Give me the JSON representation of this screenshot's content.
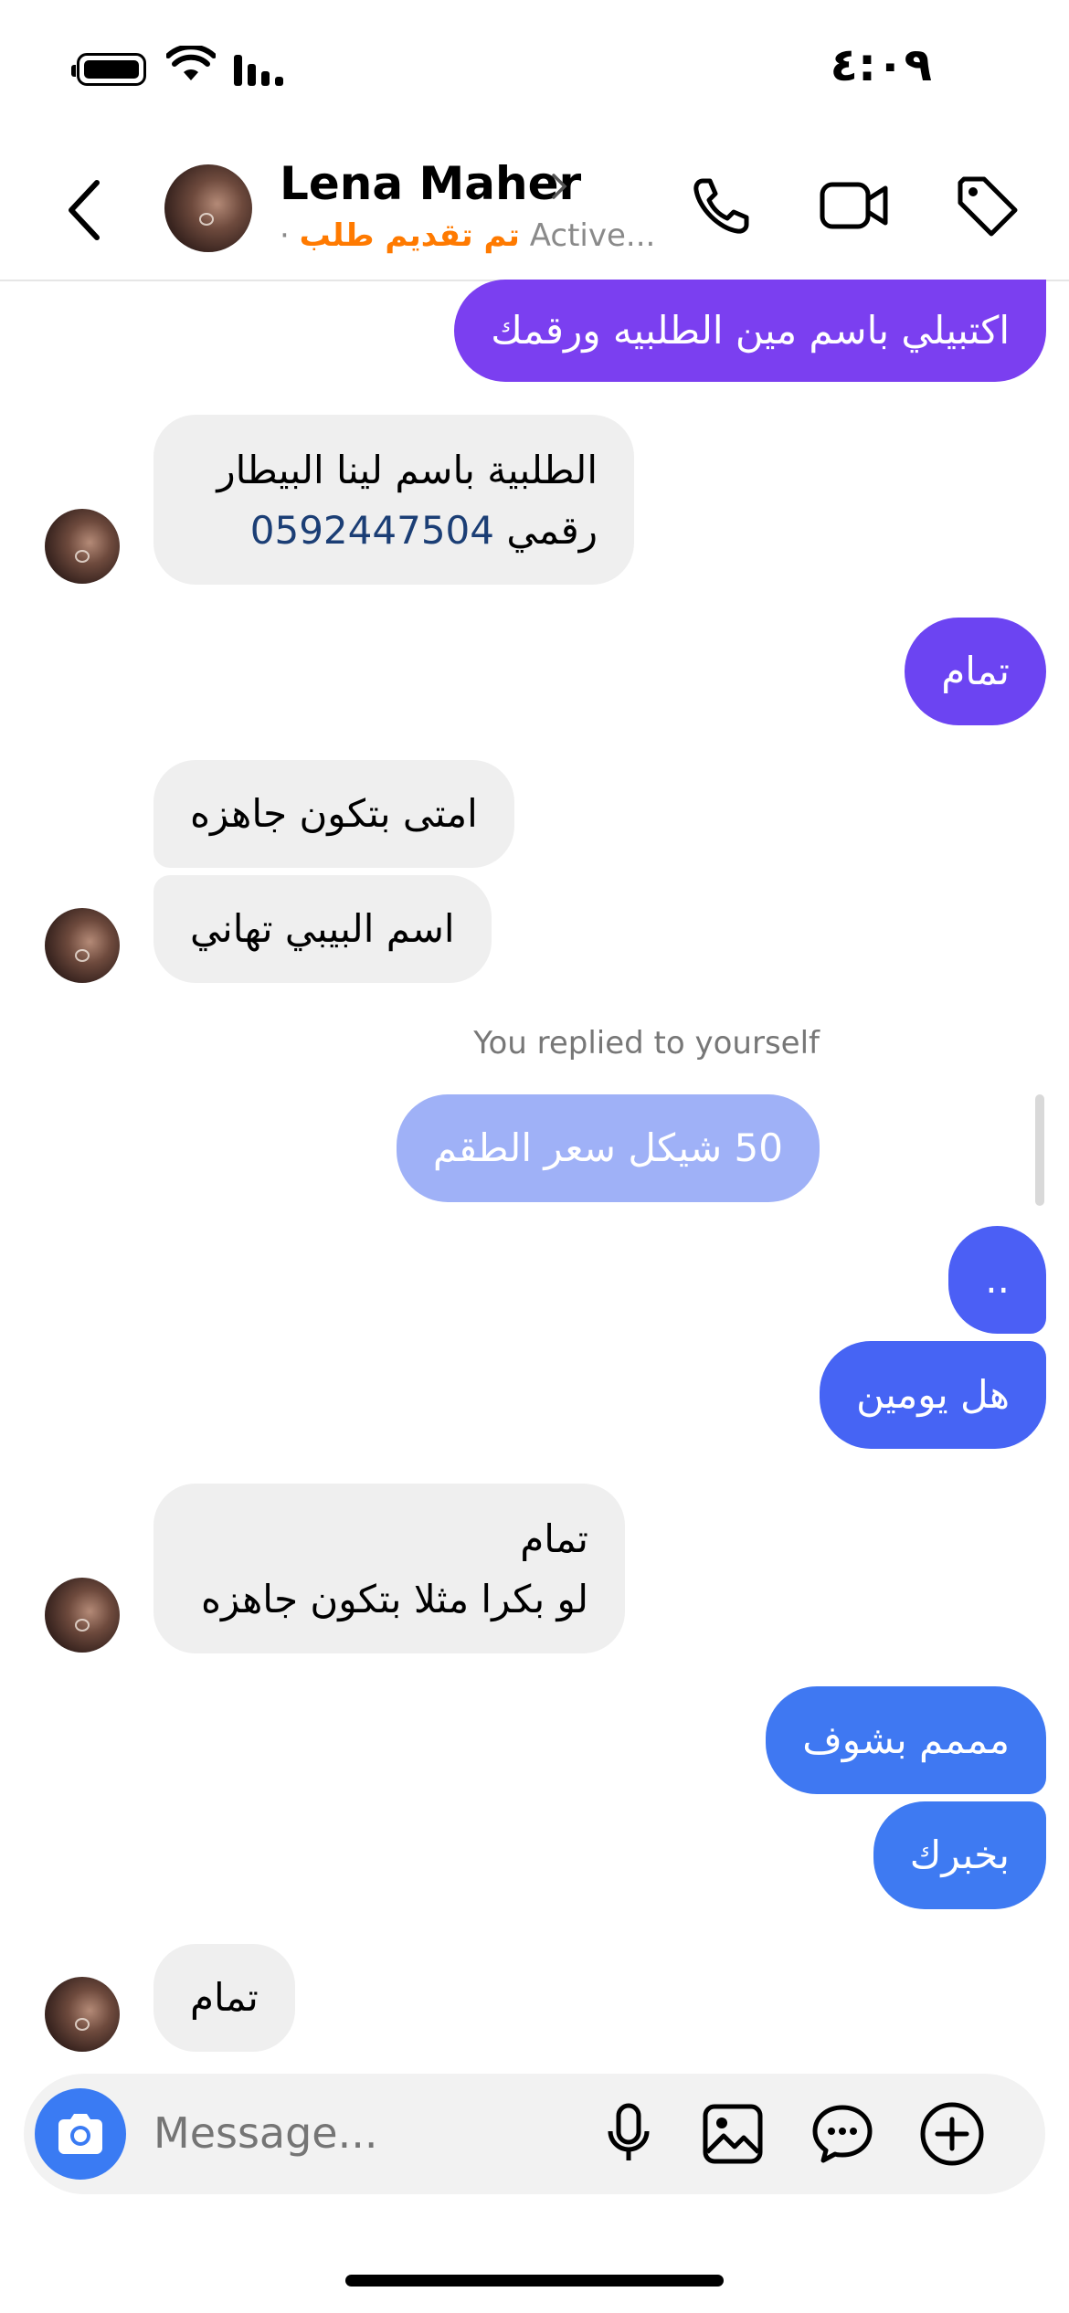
{
  "status_bar": {
    "time": "٤:٠٩"
  },
  "header": {
    "contact_name": "Lena Maher",
    "subtitle_status": "Active...",
    "subtitle_tag": "تم تقديم طلب",
    "subtitle_separator": "·"
  },
  "messages": [
    {
      "direction": "outgoing",
      "text": "اكتبيلي باسم مين الطلبيه ورقمك",
      "color": "#7b3ff0"
    },
    {
      "direction": "incoming",
      "line1": "الطلبية باسم لينا البيطار",
      "line2_prefix": "رقمي",
      "line2_phone": "0592447504"
    },
    {
      "direction": "outgoing",
      "text": "تمام",
      "color": "#6c44f2"
    },
    {
      "direction": "incoming",
      "text": "امتى بتكون جاهزه"
    },
    {
      "direction": "incoming",
      "text": "اسم البيبي تهاني"
    },
    {
      "direction": "meta",
      "text": "You replied to yourself"
    },
    {
      "direction": "outgoing-faded",
      "text": "50 شيكل سعر الطقم",
      "color": "#9fb1f7"
    },
    {
      "direction": "outgoing",
      "text": "..",
      "color": "#4b5ff5"
    },
    {
      "direction": "outgoing",
      "text": "هل يومين",
      "color": "#4664f4"
    },
    {
      "direction": "incoming",
      "line1": "تمام",
      "line2": "لو بكرا مثلا بتكون جاهزه"
    },
    {
      "direction": "outgoing",
      "text": "مممم بشوف",
      "color": "#3f78f2"
    },
    {
      "direction": "outgoing",
      "text": "بخبرك",
      "color": "#3e7af2"
    },
    {
      "direction": "incoming",
      "text": "تمام"
    }
  ],
  "composer": {
    "placeholder": "Message...",
    "icons": [
      "camera-icon",
      "microphone-icon",
      "gallery-icon",
      "sticker-icon",
      "plus-icon"
    ]
  },
  "header_icons": [
    "back-icon",
    "phone-icon",
    "video-icon",
    "tag-icon"
  ]
}
